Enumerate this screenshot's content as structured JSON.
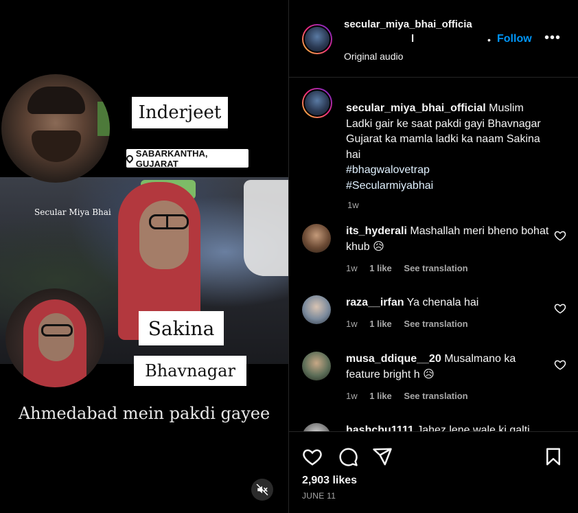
{
  "media": {
    "label_name": "Inderjeet",
    "label_location": "SABARKANTHA, GUJARAT",
    "watermark": "Secular Miya Bhai",
    "label_name2": "Sakina",
    "label_place": "Bhavnagar",
    "caption": "Ahmedabad mein pakdi gayee",
    "mute_icon": "muted-speaker-icon"
  },
  "header": {
    "username_line1": "secular_miya_bhai_officia",
    "username_line2": "l",
    "separator": "•",
    "follow_label": "Follow",
    "more_label": "•••",
    "audio_label": "Original audio"
  },
  "post": {
    "username": "secular_miya_bhai_official",
    "caption": "Muslim Ladki gair ke saat pakdi gayi Bhavnagar Gujarat ka mamla ladki ka naam Sakina hai",
    "hashtag1": "#bhagwalovetrap",
    "hashtag2": "#Secularmiyabhai",
    "time": "1w"
  },
  "comments": [
    {
      "username": "its_hyderali",
      "text": "Mashallah meri bheno bohat khub 😥",
      "time": "1w",
      "likes": "1 like",
      "translate": "See translation"
    },
    {
      "username": "raza__irfan",
      "text": "Ya chenala hai",
      "time": "1w",
      "likes": "1 like",
      "translate": "See translation"
    },
    {
      "username": "musa_ddique__20",
      "text": "Musalmano ka feature bright h 😥",
      "time": "1w",
      "likes": "1 like",
      "translate": "See translation"
    },
    {
      "username": "hashchu1111",
      "text": "Jahez lene wale ki galti"
    }
  ],
  "footer": {
    "likes": "2,903 likes",
    "date": "JUNE 11"
  },
  "colors": {
    "accent": "#0095f6",
    "background": "#000000",
    "muted": "#a8a8a8"
  }
}
